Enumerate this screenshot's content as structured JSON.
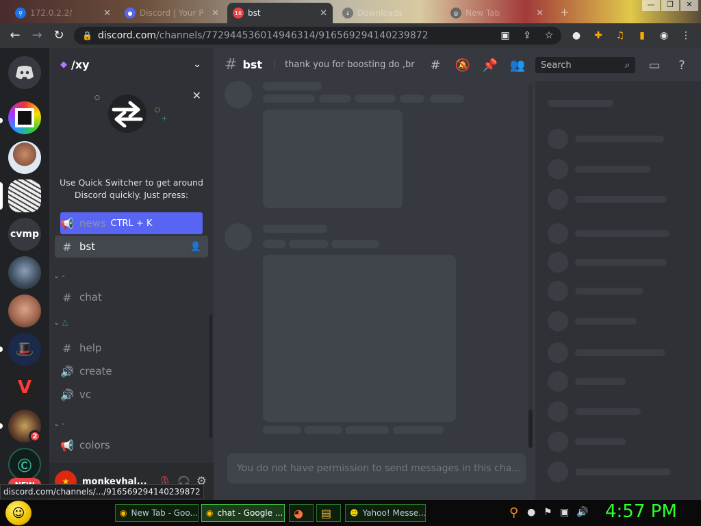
{
  "browser": {
    "tabs": [
      {
        "label": "172.0.2.2/",
        "active": false,
        "favicon": "map-pin-icon"
      },
      {
        "label": "Discord | Your P",
        "active": false,
        "favicon": "discord-icon"
      },
      {
        "label": "bst",
        "active": true,
        "favicon": "discord-icon",
        "badge": "16"
      },
      {
        "label": "Downloads",
        "active": false,
        "favicon": "download-icon"
      },
      {
        "label": "New Tab",
        "active": false,
        "favicon": "chrome-icon"
      }
    ],
    "url_domain": "discord.com",
    "url_path": "/channels/772944536014946314/916569294140239872",
    "status_url": "discord.com/channels/.../916569294140239872"
  },
  "discord": {
    "server_rail": [
      {
        "name": "discord-home",
        "label": ""
      },
      {
        "name": "server-colorful",
        "label": ""
      },
      {
        "name": "server-rock",
        "label": ""
      },
      {
        "name": "server-sketch",
        "label": ""
      },
      {
        "name": "server-cvmp",
        "label": "cvmp"
      },
      {
        "name": "server-helmet",
        "label": ""
      },
      {
        "name": "server-face",
        "label": ""
      },
      {
        "name": "server-monopoly",
        "label": ""
      },
      {
        "name": "server-red",
        "label": ""
      },
      {
        "name": "server-anime",
        "label": "",
        "mentions": "2"
      },
      {
        "name": "server-c",
        "label": ""
      },
      {
        "name": "server-new",
        "label": "NEW"
      }
    ],
    "guild": {
      "name": "/xy"
    },
    "quick_switcher": {
      "text": "Use Quick Switcher to get around Discord quickly. Just press:",
      "button": "CTRL + K"
    },
    "channels": [
      {
        "type": "announcement",
        "name": "news"
      },
      {
        "type": "text",
        "name": "bst",
        "selected": true
      },
      {
        "type": "category",
        "name": "-"
      },
      {
        "type": "text",
        "name": "chat"
      },
      {
        "type": "category",
        "name": ""
      },
      {
        "type": "text",
        "name": "help"
      },
      {
        "type": "voice",
        "name": "create"
      },
      {
        "type": "voice",
        "name": "vc"
      },
      {
        "type": "category",
        "name": "-"
      },
      {
        "type": "announcement",
        "name": "colors"
      }
    ],
    "user": {
      "name": "monkeyhal..."
    },
    "channel_header": {
      "name": "bst",
      "topic": "thank you for boosting do ,br"
    },
    "search_placeholder": "Search",
    "composer_placeholder": "You do not have permission to send messages in this cha..."
  },
  "taskbar": {
    "items": [
      {
        "label": "New Tab - Goo...",
        "active": false,
        "icon": "chrome-icon"
      },
      {
        "label": "chat - Google ...",
        "active": true,
        "icon": "chrome-icon"
      },
      {
        "label": "",
        "active": false,
        "icon": "firefox-icon"
      },
      {
        "label": "",
        "active": false,
        "icon": "folder-icon"
      },
      {
        "label": "Yahoo! Messe...",
        "active": false,
        "icon": "yahoo-messenger-icon"
      }
    ],
    "clock": "4:57 PM"
  }
}
